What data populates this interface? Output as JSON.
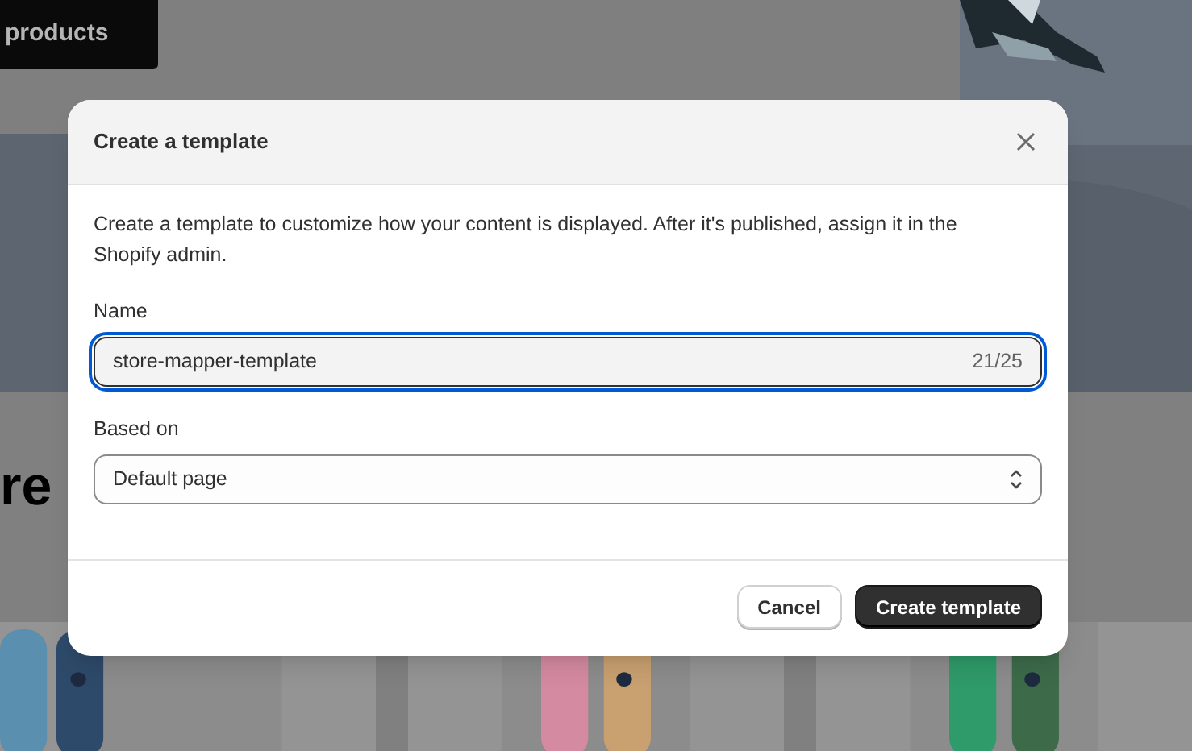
{
  "page": {
    "button": "products",
    "heading": "re"
  },
  "dialog": {
    "title": "Create a template",
    "description": "Create a template to customize how your content is displayed. After it's published, assign it in the Shopify admin.",
    "name_field": {
      "label": "Name",
      "value": "store-mapper-template",
      "counter": "21/25",
      "focused": true
    },
    "based_on": {
      "label": "Based on",
      "value": "Default page"
    },
    "buttons": [
      {
        "label": "Cancel",
        "kind": "secondary"
      },
      {
        "label": "Create template",
        "kind": "primary"
      }
    ]
  }
}
